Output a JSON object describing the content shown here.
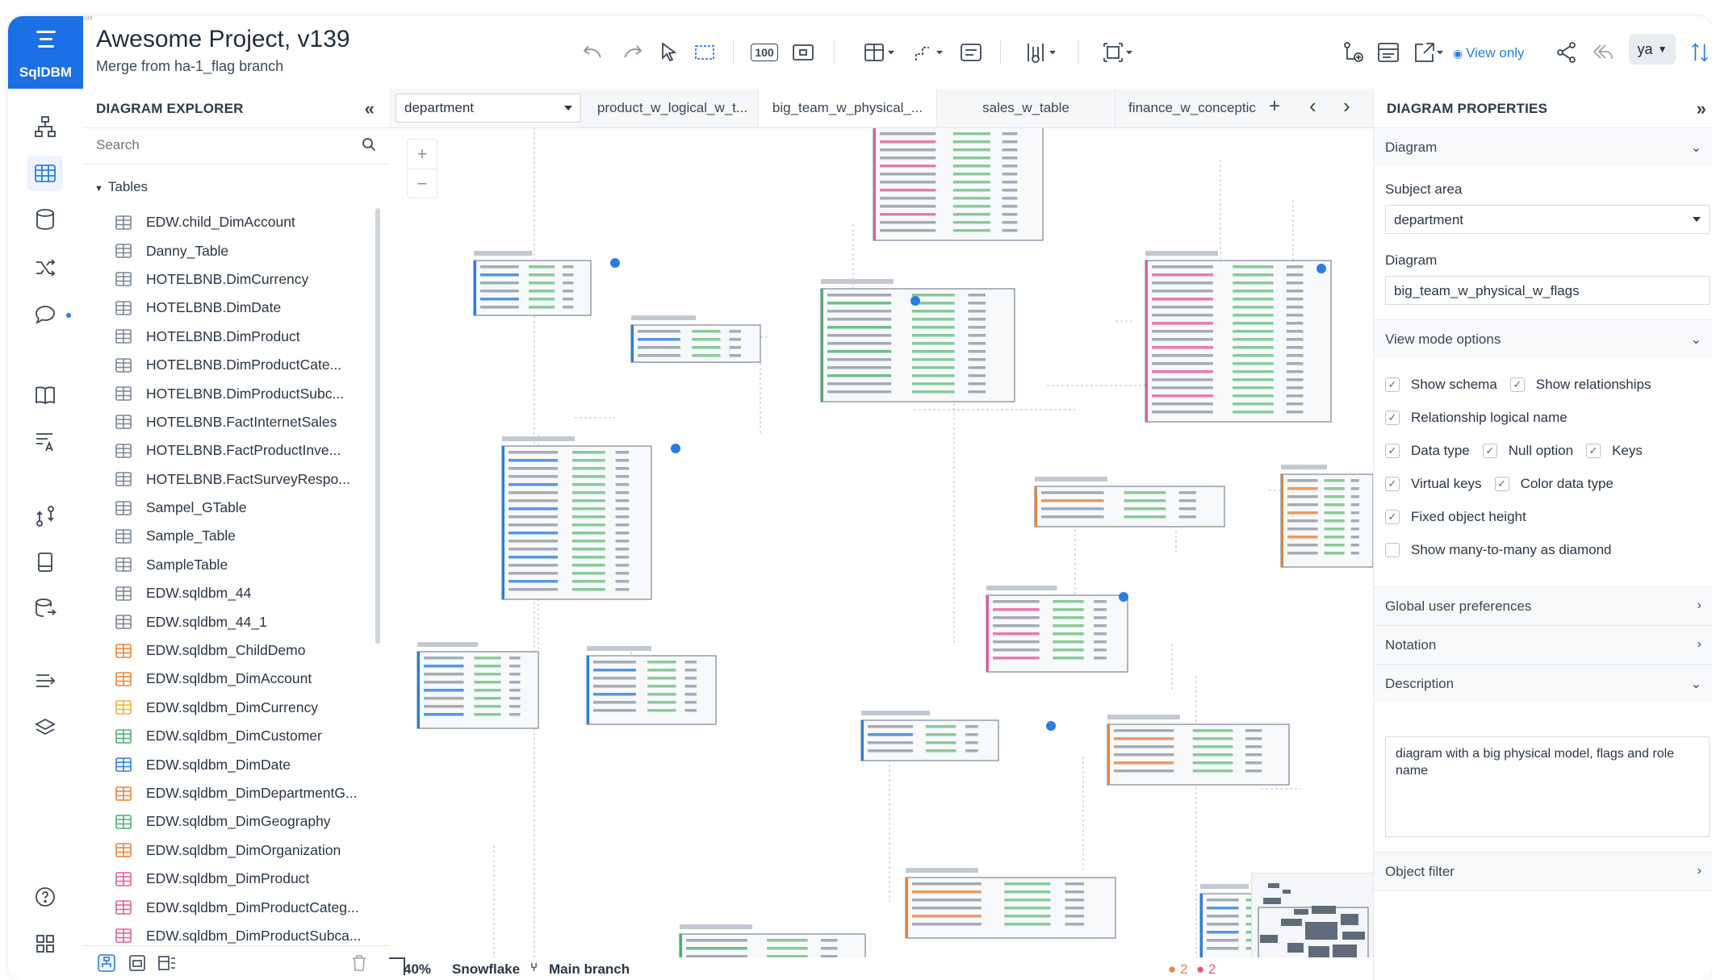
{
  "app": {
    "logo_text": "SqlDBM",
    "title": "Awesome Project, v139",
    "subtitle": "Merge from ha-1_flag branch",
    "tm_mark": "TM"
  },
  "toolbar": {
    "zoom_100_label": "100",
    "view_only_label": "View only",
    "user_initials": "ya"
  },
  "explorer": {
    "header": "DIAGRAM EXPLORER",
    "collapse_label": "«",
    "search_placeholder": "Search",
    "group_label": "Tables",
    "tables": [
      {
        "name": "EDW.child_DimAccount",
        "color": "#7a8596"
      },
      {
        "name": "Danny_Table",
        "color": "#7a8596"
      },
      {
        "name": "HOTELBNB.DimCurrency",
        "color": "#7a8596"
      },
      {
        "name": "HOTELBNB.DimDate",
        "color": "#7a8596"
      },
      {
        "name": "HOTELBNB.DimProduct",
        "color": "#7a8596"
      },
      {
        "name": "HOTELBNB.DimProductCate...",
        "color": "#7a8596"
      },
      {
        "name": "HOTELBNB.DimProductSubc...",
        "color": "#7a8596"
      },
      {
        "name": "HOTELBNB.FactInternetSales",
        "color": "#7a8596"
      },
      {
        "name": "HOTELBNB.FactProductInve...",
        "color": "#7a8596"
      },
      {
        "name": "HOTELBNB.FactSurveyRespo...",
        "color": "#7a8596"
      },
      {
        "name": "Sampel_GTable",
        "color": "#7a8596"
      },
      {
        "name": "Sample_Table",
        "color": "#7a8596"
      },
      {
        "name": "SampleTable",
        "color": "#7a8596"
      },
      {
        "name": "EDW.sqldbm_44",
        "color": "#7a8596"
      },
      {
        "name": "EDW.sqldbm_44_1",
        "color": "#7a8596"
      },
      {
        "name": "EDW.sqldbm_ChildDemo",
        "color": "#e8833a"
      },
      {
        "name": "EDW.sqldbm_DimAccount",
        "color": "#e8833a"
      },
      {
        "name": "EDW.sqldbm_DimCurrency",
        "color": "#f0b03c"
      },
      {
        "name": "EDW.sqldbm_DimCustomer",
        "color": "#4caf6e"
      },
      {
        "name": "EDW.sqldbm_DimDate",
        "color": "#2a7de1"
      },
      {
        "name": "EDW.sqldbm_DimDepartmentG...",
        "color": "#e8833a"
      },
      {
        "name": "EDW.sqldbm_DimGeography",
        "color": "#4caf6e"
      },
      {
        "name": "EDW.sqldbm_DimOrganization",
        "color": "#e8833a"
      },
      {
        "name": "EDW.sqldbm_DimProduct",
        "color": "#e25c9a"
      },
      {
        "name": "EDW.sqldbm_DimProductCateg...",
        "color": "#e25c9a"
      },
      {
        "name": "EDW.sqldbm_DimProductSubca...",
        "color": "#e25c9a"
      }
    ]
  },
  "canvas": {
    "subject_select": "department",
    "tabs": [
      "product_w_logical_w_t...",
      "big_team_w_physical_...",
      "sales_w_table",
      "finance_w_conceptic"
    ],
    "add_tab": "+",
    "prev": "‹",
    "next": "›",
    "zoom_in": "+",
    "zoom_out": "−",
    "footer": {
      "zoom": "40%",
      "db": "Snowflake",
      "branch": "Main branch"
    },
    "minimap_badges": [
      "2",
      "2"
    ]
  },
  "properties": {
    "header": "DIAGRAM PROPERTIES",
    "expand_label": "»",
    "diagram_section": "Diagram",
    "subject_area_label": "Subject area",
    "subject_area_value": "department",
    "diagram_label": "Diagram",
    "diagram_value": "big_team_w_physical_w_flags",
    "view_mode_section": "View mode options",
    "options": {
      "show_schema": "Show schema",
      "show_relationships": "Show relationships",
      "relationship_logical_name": "Relationship logical name",
      "data_type": "Data type",
      "null_option": "Null option",
      "keys": "Keys",
      "virtual_keys": "Virtual keys",
      "color_data_type": "Color data type",
      "fixed_object_height": "Fixed object height",
      "show_many_to_many": "Show many-to-many as diamond"
    },
    "global_prefs": "Global user preferences",
    "notation": "Notation",
    "description_section": "Description",
    "description_text": "diagram with a big physical model, flags and role name",
    "object_filter": "Object filter"
  }
}
